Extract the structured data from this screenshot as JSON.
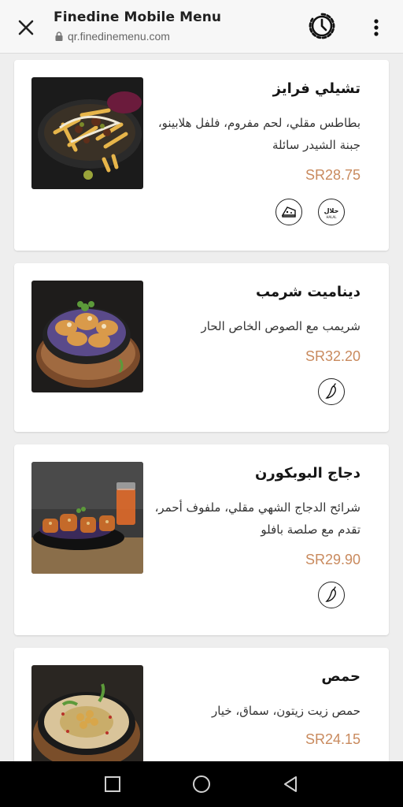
{
  "header": {
    "title": "Finedine Mobile Menu",
    "url": "qr.finedinemenu.com",
    "close_icon": "close-icon",
    "timer_icon": "timer-icon",
    "more_icon": "more-vertical-icon"
  },
  "colors": {
    "price": "#c98a5e",
    "card": "#ffffff",
    "background": "#eeeeee"
  },
  "items": [
    {
      "name": "تشيلي فرايز",
      "description": "بطاطس مقلي، لحم مفروم، فلفل هلابينو، جبنة الشيدر سائلة",
      "price": "SR28.75",
      "badges": [
        {
          "icon": "halal-icon",
          "text": "حلال",
          "subtext": "HALAL"
        },
        {
          "icon": "cheese-icon"
        }
      ]
    },
    {
      "name": "ديناميت شرمب",
      "description": "شريمب مع الصوص الخاص الحار",
      "price": "SR32.20",
      "badges": [
        {
          "icon": "chili-icon"
        }
      ]
    },
    {
      "name": "دجاج البوبكورن",
      "description": "شرائح الدجاج الشهي مقلي، ملفوف أحمر، تقدم مع صلصة بافلو",
      "price": "SR29.90",
      "badges": [
        {
          "icon": "chili-icon"
        }
      ]
    },
    {
      "name": "حمص",
      "description": "حمص زيت زيتون، سماق، خيار",
      "price": "SR24.15",
      "badges": []
    }
  ],
  "navbar": {
    "recents_icon": "square-recents-icon",
    "home_icon": "circle-home-icon",
    "back_icon": "triangle-back-icon"
  }
}
